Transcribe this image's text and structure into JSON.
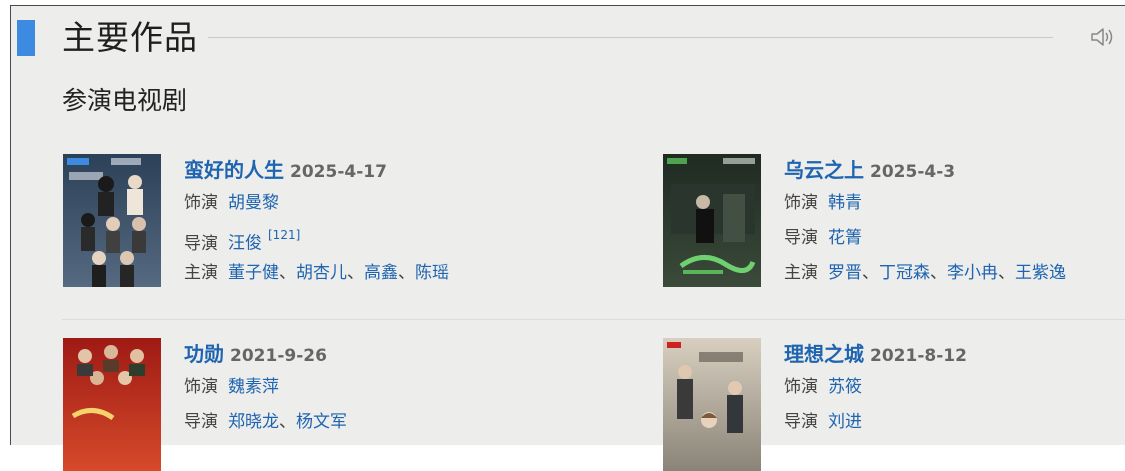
{
  "section": {
    "title": "主要作品"
  },
  "subsection": {
    "title": "参演电视剧"
  },
  "works": [
    {
      "title": "蛮好的人生",
      "date": "2025-4-17",
      "role_label": "饰演",
      "role": "胡曼黎",
      "director_label": "导演",
      "director": "汪俊",
      "director_cite": "[121]",
      "cast_label": "主演",
      "cast": [
        "董子健",
        "胡杏儿",
        "高鑫",
        "陈瑶"
      ],
      "poster_colors": [
        "#2c4058",
        "#556a80"
      ]
    },
    {
      "title": "乌云之上",
      "date": "2025-4-3",
      "role_label": "饰演",
      "role": "韩青",
      "director_label": "导演",
      "director": "花箐",
      "cast_label": "主演",
      "cast": [
        "罗晋",
        "丁冠森",
        "李小冉",
        "王紫逸"
      ],
      "poster_colors": [
        "#1f2a22",
        "#3b4a3a"
      ]
    },
    {
      "title": "功勋",
      "date": "2021-9-26",
      "role_label": "饰演",
      "role": "魏素萍",
      "director_label": "导演",
      "director": [
        "郑晓龙",
        "杨文军"
      ],
      "poster_colors": [
        "#9e1a14",
        "#d64a2a"
      ]
    },
    {
      "title": "理想之城",
      "date": "2021-8-12",
      "role_label": "饰演",
      "role": "苏筱",
      "director_label": "导演",
      "director": "刘进",
      "poster_colors": [
        "#d8cfc0",
        "#8a8478"
      ]
    }
  ],
  "list_separator": "、",
  "icons": {
    "speaker": "speaker-icon"
  },
  "colors": {
    "accent": "#3d8be0",
    "link": "#1e64b0",
    "background": "#ededeb"
  }
}
